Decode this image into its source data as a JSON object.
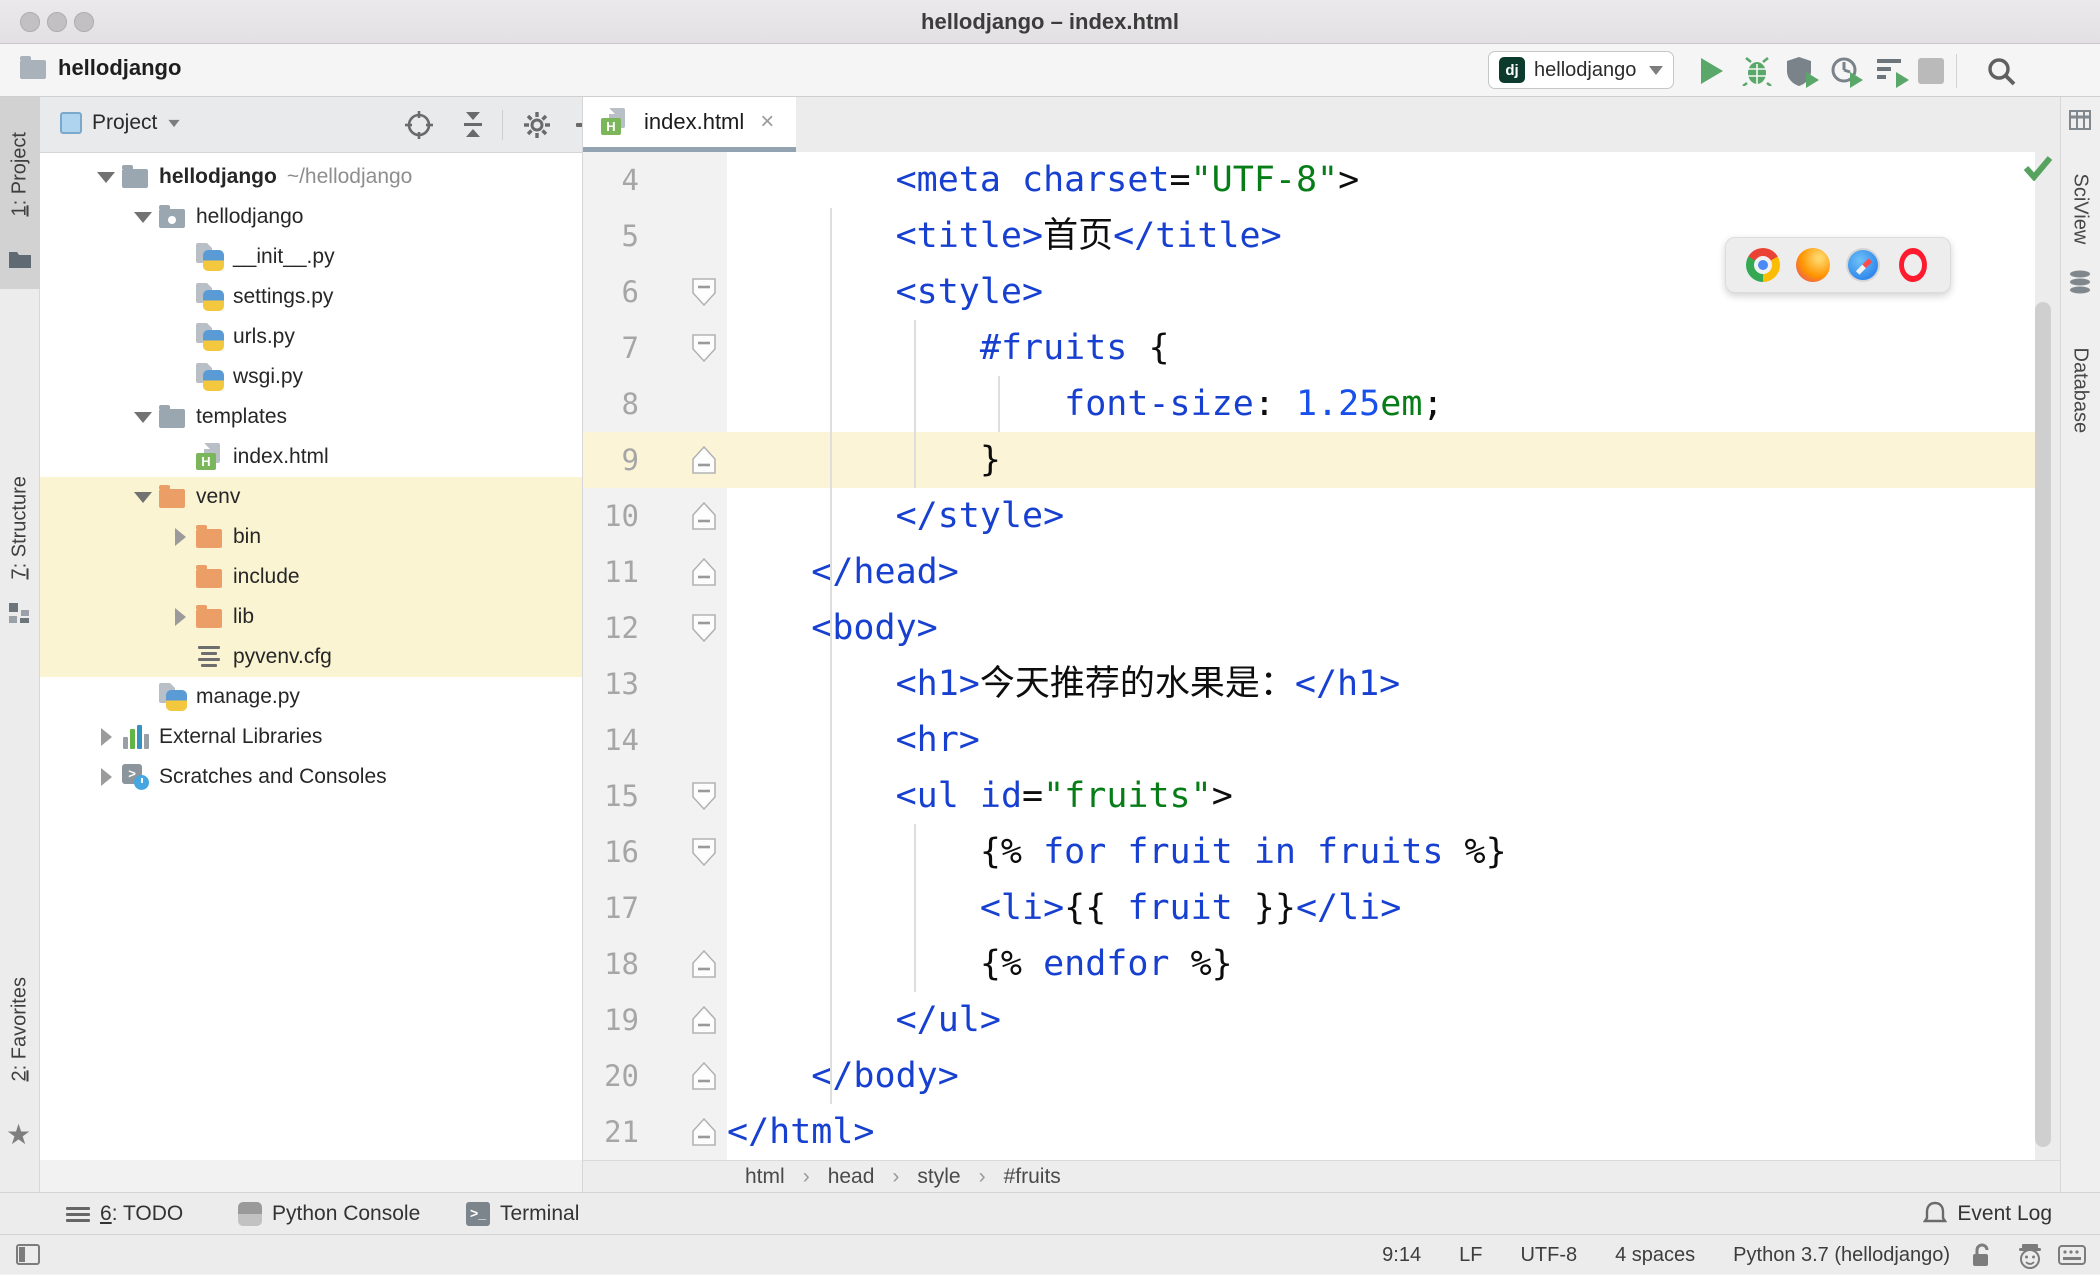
{
  "window": {
    "title": "hellodjango – index.html"
  },
  "toolbar": {
    "project_crumb": "hellodjango",
    "run_config": {
      "badge": "dj",
      "label": "hellodjango"
    },
    "buttons": [
      "run",
      "debug",
      "run-with-coverage",
      "profile",
      "run-with-settings",
      "stop",
      "search-everywhere"
    ]
  },
  "left_stripe": {
    "items": [
      {
        "num": "1",
        "rest": ": Project",
        "icon": "folder-icon",
        "active": true
      },
      {
        "num": "7",
        "rest": ": Structure",
        "icon": "structure-icon",
        "active": false
      },
      {
        "num": "2",
        "rest": ": Favorites",
        "icon": "star-icon",
        "active": false
      }
    ]
  },
  "right_stripe": {
    "items": [
      {
        "label": "SciView",
        "icon": "grid-icon"
      },
      {
        "label": "Database",
        "icon": "database-icon"
      }
    ]
  },
  "project_panel": {
    "header": {
      "title": "Project",
      "icons": [
        "locate",
        "collapse-all",
        "settings",
        "hide"
      ]
    },
    "tree": [
      {
        "depth": 0,
        "arrow": "open",
        "icon": "folder",
        "label": "hellodjango",
        "suffix": "~/hellodjango",
        "bold": true
      },
      {
        "depth": 1,
        "arrow": "open",
        "icon": "folder-dot",
        "label": "hellodjango"
      },
      {
        "depth": 2,
        "arrow": null,
        "icon": "py",
        "label": "__init__.py"
      },
      {
        "depth": 2,
        "arrow": null,
        "icon": "py",
        "label": "settings.py"
      },
      {
        "depth": 2,
        "arrow": null,
        "icon": "py",
        "label": "urls.py"
      },
      {
        "depth": 2,
        "arrow": null,
        "icon": "py",
        "label": "wsgi.py"
      },
      {
        "depth": 1,
        "arrow": "open",
        "icon": "folder",
        "label": "templates"
      },
      {
        "depth": 2,
        "arrow": null,
        "icon": "html",
        "label": "index.html"
      },
      {
        "depth": 1,
        "arrow": "open",
        "icon": "folder-ex",
        "label": "venv",
        "excluded": true
      },
      {
        "depth": 2,
        "arrow": "closed",
        "icon": "folder-ex",
        "label": "bin",
        "excluded": true
      },
      {
        "depth": 2,
        "arrow": null,
        "icon": "folder-ex",
        "label": "include",
        "excluded": true
      },
      {
        "depth": 2,
        "arrow": "closed",
        "icon": "folder-ex",
        "label": "lib",
        "excluded": true
      },
      {
        "depth": 2,
        "arrow": null,
        "icon": "cfg",
        "label": "pyvenv.cfg",
        "excluded": true
      },
      {
        "depth": 1,
        "arrow": null,
        "icon": "py",
        "label": "manage.py"
      },
      {
        "depth": 0,
        "arrow": "closed",
        "icon": "libs",
        "label": "External Libraries"
      },
      {
        "depth": 0,
        "arrow": "closed",
        "icon": "scratch",
        "label": "Scratches and Consoles"
      }
    ]
  },
  "editor": {
    "tab": {
      "name": "index.html",
      "close": "×"
    },
    "colors": {
      "tag": "#1740d0",
      "attr": "#1740d0",
      "num": "#1750eb",
      "str": "#067d17",
      "blk": "#0d0d0d"
    },
    "lines": [
      {
        "n": 4,
        "fold": null,
        "tokens": [
          [
            "        <meta ",
            "tag"
          ],
          [
            "charset",
            "attr"
          ],
          [
            "=",
            "blk"
          ],
          [
            "\"UTF-8\"",
            "str"
          ],
          [
            ">",
            "blk"
          ]
        ]
      },
      {
        "n": 5,
        "fold": null,
        "tokens": [
          [
            "        <title>",
            "tag"
          ],
          [
            "首页",
            "blk"
          ],
          [
            "</title>",
            "tag"
          ]
        ]
      },
      {
        "n": 6,
        "fold": "down",
        "tokens": [
          [
            "        <style>",
            "tag"
          ]
        ]
      },
      {
        "n": 7,
        "fold": "down",
        "tokens": [
          [
            "            ",
            "blk"
          ],
          [
            "#fruits",
            "tag"
          ],
          [
            " {",
            "blk"
          ]
        ]
      },
      {
        "n": 8,
        "fold": null,
        "tokens": [
          [
            "                ",
            "blk"
          ],
          [
            "font-size",
            "tag"
          ],
          [
            ": ",
            "blk"
          ],
          [
            "1.25",
            "num"
          ],
          [
            "em",
            "str"
          ],
          [
            ";",
            "blk"
          ]
        ]
      },
      {
        "n": 9,
        "fold": "up",
        "current": true,
        "tokens": [
          [
            "            }",
            "blk"
          ]
        ]
      },
      {
        "n": 10,
        "fold": "up",
        "tokens": [
          [
            "        </style>",
            "tag"
          ]
        ]
      },
      {
        "n": 11,
        "fold": "up",
        "tokens": [
          [
            "    </head>",
            "tag"
          ]
        ]
      },
      {
        "n": 12,
        "fold": "down",
        "tokens": [
          [
            "    <body>",
            "tag"
          ]
        ]
      },
      {
        "n": 13,
        "fold": null,
        "tokens": [
          [
            "        <h1>",
            "tag"
          ],
          [
            "今天推荐的水果是：",
            "blk"
          ],
          [
            "</h1>",
            "tag"
          ]
        ]
      },
      {
        "n": 14,
        "fold": null,
        "tokens": [
          [
            "        <hr>",
            "tag"
          ]
        ]
      },
      {
        "n": 15,
        "fold": "down",
        "tokens": [
          [
            "        <ul ",
            "tag"
          ],
          [
            "id",
            "attr"
          ],
          [
            "=",
            "blk"
          ],
          [
            "\"fruits\"",
            "str"
          ],
          [
            ">",
            "blk"
          ]
        ]
      },
      {
        "n": 16,
        "fold": "down",
        "tokens": [
          [
            "            {% ",
            "blk"
          ],
          [
            "for",
            "tag"
          ],
          [
            " ",
            "blk"
          ],
          [
            "fruit",
            "tag"
          ],
          [
            " ",
            "blk"
          ],
          [
            "in",
            "tag"
          ],
          [
            " ",
            "blk"
          ],
          [
            "fruits",
            "tag"
          ],
          [
            " %}",
            "blk"
          ]
        ]
      },
      {
        "n": 17,
        "fold": null,
        "tokens": [
          [
            "            <li>",
            "tag"
          ],
          [
            "{{ ",
            "blk"
          ],
          [
            "fruit",
            "tag"
          ],
          [
            " }}",
            "blk"
          ],
          [
            "</li>",
            "tag"
          ]
        ]
      },
      {
        "n": 18,
        "fold": "up",
        "tokens": [
          [
            "            {% ",
            "blk"
          ],
          [
            "endfor",
            "tag"
          ],
          [
            " %}",
            "blk"
          ]
        ]
      },
      {
        "n": 19,
        "fold": "up",
        "tokens": [
          [
            "        </ul>",
            "tag"
          ]
        ]
      },
      {
        "n": 20,
        "fold": "up",
        "tokens": [
          [
            "    </body>",
            "tag"
          ]
        ]
      },
      {
        "n": 21,
        "fold": "up",
        "tokens": [
          [
            "</html>",
            "tag"
          ]
        ]
      }
    ],
    "breadcrumbs": [
      "html",
      "head",
      "style",
      "#fruits"
    ],
    "inspection_status": "ok",
    "browser_popup": [
      "chrome",
      "firefox",
      "safari",
      "opera"
    ]
  },
  "bottom_bar": {
    "items": [
      {
        "num": "6",
        "rest": ": TODO",
        "icon": "todo-list-icon"
      },
      {
        "label": "Python Console",
        "icon": "python-icon"
      },
      {
        "label": "Terminal",
        "icon": "terminal-icon"
      }
    ],
    "event_log": "Event Log"
  },
  "status_bar": {
    "position": "9:14",
    "line_separator": "LF",
    "encoding": "UTF-8",
    "indent": "4 spaces",
    "interpreter": "Python 3.7 (hellodjango)"
  }
}
